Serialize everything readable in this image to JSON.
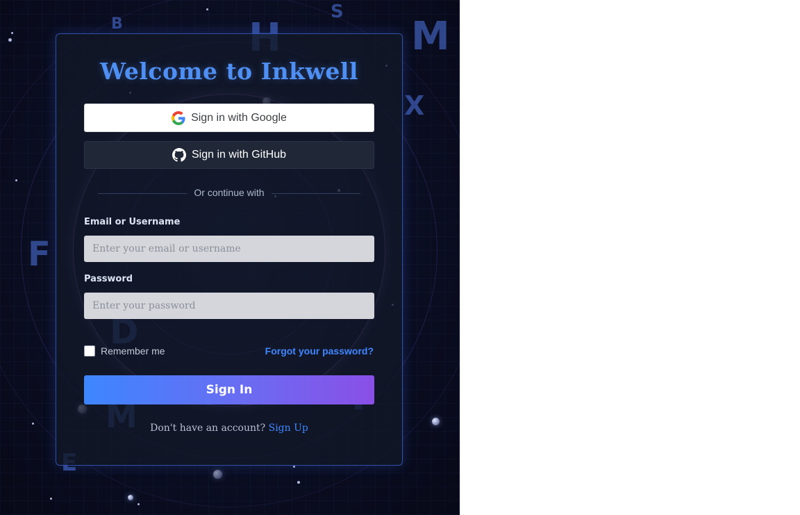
{
  "card": {
    "title": "Welcome to Inkwell",
    "google_button": "Sign in with Google",
    "github_button": "Sign in with GitHub",
    "divider_text": "Or continue with",
    "email_label": "Email or Username",
    "email_placeholder": "Enter your email or username",
    "password_label": "Password",
    "password_placeholder": "Enter your password",
    "remember_label": "Remember me",
    "remember_checked": false,
    "forgot_link": "Forgot your password?",
    "signin_button": "Sign In",
    "signup_prompt": "Don't have an account?",
    "signup_link": "Sign Up"
  },
  "background": {
    "runes": [
      "B",
      "H",
      "M",
      "X",
      "F",
      "D",
      "M",
      "Y",
      "E",
      "S"
    ]
  },
  "colors": {
    "accent": "#4f8ff2",
    "link": "#3f86ff",
    "gradient_start": "#3d86ff",
    "gradient_end": "#8a4fe6"
  },
  "icons": {
    "google": "google-g-icon",
    "github": "github-icon"
  }
}
